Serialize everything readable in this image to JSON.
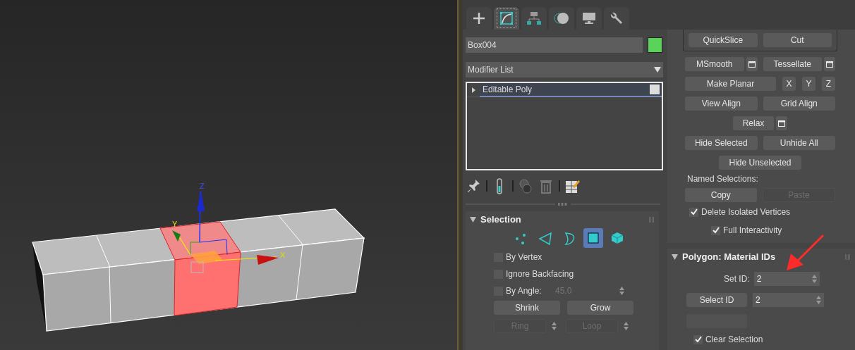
{
  "viewport": {
    "axis_labels": [
      "Z",
      "Y",
      "X"
    ]
  },
  "command_panel": {
    "tabs": [
      {
        "selected": false
      },
      {
        "selected": true
      },
      {
        "selected": false
      },
      {
        "selected": false
      },
      {
        "selected": false
      },
      {
        "selected": false
      }
    ],
    "object_name": "Box004",
    "object_swatch": {
      "color": "#5bd35b"
    },
    "modifier_list": "Modifier List",
    "stack": [
      {
        "label": "Editable Poly",
        "selected": true
      }
    ],
    "selection": {
      "title": "Selection",
      "modes": [
        {
          "selected": false
        },
        {
          "selected": false
        },
        {
          "selected": false
        },
        {
          "selected": true
        },
        {
          "selected": false
        }
      ],
      "checkboxes": [
        {
          "label": "By Vertex",
          "checked": false
        },
        {
          "label": "Ignore Backfacing",
          "checked": false
        },
        {
          "label": "By Angle:",
          "checked": false,
          "value": "45.0"
        }
      ],
      "buttons": [
        {
          "label": "Shrink",
          "disabled": false
        },
        {
          "label": "Grow",
          "disabled": false
        }
      ],
      "spin_buttons": [
        {
          "label": "Ring",
          "disabled": true
        },
        {
          "label": "Loop",
          "disabled": true
        }
      ]
    },
    "edit_geometry": {
      "rows": [
        {
          "kind": "group",
          "items": [
            {
              "kind": "button",
              "label": "QuickSlice",
              "disabled": false
            },
            {
              "kind": "button",
              "label": "Cut",
              "disabled": false
            }
          ]
        },
        {
          "kind": "pair",
          "items": [
            {
              "kind": "button",
              "label": "MSmooth",
              "disabled": false
            },
            {
              "kind": "settings"
            },
            {
              "kind": "button",
              "label": "Tessellate",
              "disabled": false
            },
            {
              "kind": "settings"
            }
          ]
        },
        {
          "kind": "pair",
          "items": [
            {
              "kind": "button",
              "label": "Make Planar",
              "disabled": false
            },
            {
              "kind": "axis",
              "label": "X",
              "disabled": false
            },
            {
              "kind": "axis",
              "label": "Y",
              "disabled": false
            },
            {
              "kind": "axis",
              "label": "Z",
              "disabled": false
            }
          ]
        },
        {
          "kind": "pair",
          "items": [
            {
              "kind": "button",
              "label": "View Align",
              "disabled": false
            },
            {
              "kind": "button",
              "label": "Grid Align",
              "disabled": false
            }
          ]
        },
        {
          "kind": "single",
          "items": [
            {
              "kind": "button",
              "label": "Relax",
              "disabled": false
            },
            {
              "kind": "settings"
            }
          ]
        },
        {
          "kind": "pair",
          "items": [
            {
              "kind": "button",
              "label": "Hide Selected",
              "disabled": false
            },
            {
              "kind": "button",
              "label": "Unhide All",
              "disabled": false
            }
          ]
        },
        {
          "kind": "single",
          "items": [
            {
              "kind": "button",
              "label": "Hide Unselected",
              "disabled": false
            }
          ]
        }
      ],
      "named_selections_label": "Named Selections:",
      "named_buttons": [
        {
          "label": "Copy",
          "disabled": false
        },
        {
          "label": "Paste",
          "disabled": true
        }
      ],
      "checkboxes": [
        {
          "label": "Delete Isolated Vertices",
          "checked": true
        },
        {
          "label": "Full Interactivity",
          "checked": true
        }
      ]
    },
    "material_ids": {
      "title": "Polygon: Material IDs",
      "set_id_label": "Set ID:",
      "set_id_value": "2",
      "select_id_button": "Select ID",
      "select_id_value": "2",
      "checkboxes": [
        {
          "label": "Clear Selection",
          "checked": true
        }
      ]
    }
  }
}
